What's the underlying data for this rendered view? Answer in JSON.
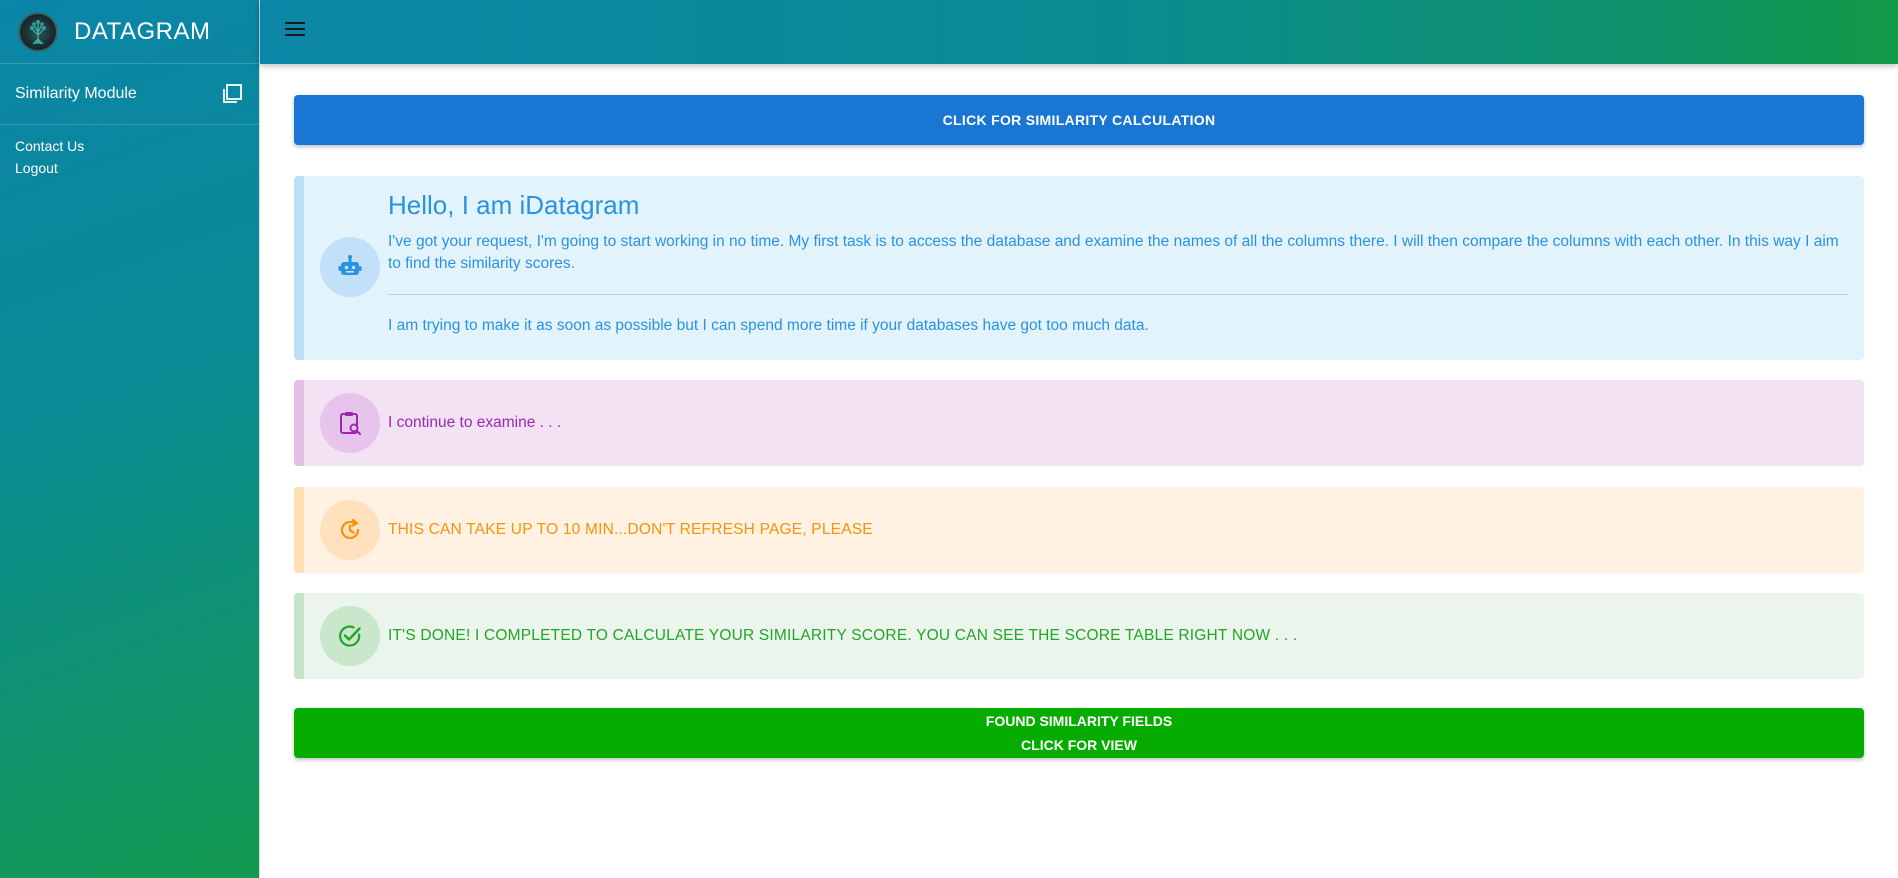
{
  "brand": {
    "name": "DATAGRAM",
    "logo_icon": "tree-logo-icon"
  },
  "sidebar": {
    "module_label": "Similarity Module",
    "module_icon": "copy-icon",
    "links": [
      {
        "label": "Contact Us"
      },
      {
        "label": "Logout"
      }
    ]
  },
  "topbar": {
    "menu_icon": "hamburger-icon"
  },
  "main": {
    "calc_button": "CLICK FOR SIMILARITY CALCULATION",
    "info": {
      "icon": "robot-icon",
      "title": "Hello, I am iDatagram",
      "text1": "I've got your request, I'm going to start working in no time. My first task is to access the database and examine the names of all the columns there. I will then compare the columns with each other. In this way I aim to find the similarity scores.",
      "text2": "I am trying to make it as soon as possible but I can spend more time if your databases have got too much data."
    },
    "examine": {
      "icon": "clipboard-search-icon",
      "text": "I continue to examine . . ."
    },
    "warning": {
      "icon": "clock-refresh-icon",
      "text": "THIS CAN TAKE UP TO 10 MIN...DON'T REFRESH PAGE, PLEASE"
    },
    "done": {
      "icon": "check-circle-icon",
      "text": "IT'S DONE! I COMPLETED TO CALCULATE YOUR SIMILARITY SCORE. YOU CAN SEE THE SCORE TABLE RIGHT NOW . . ."
    },
    "view_button": {
      "line1": "FOUND SIMILARITY FIELDS",
      "line2": "CLICK FOR VIEW"
    }
  },
  "colors": {
    "primary_button": "#1976d2",
    "success_button": "#06ad00",
    "info_text": "#2a93e0",
    "purple_text": "#9c28b0",
    "orange_text": "#f5930b",
    "green_text": "#21a528"
  }
}
